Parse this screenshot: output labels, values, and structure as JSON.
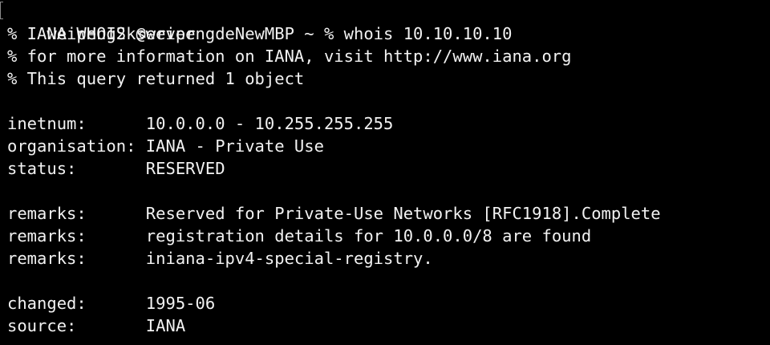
{
  "terminal": {
    "prompt": "weipeng2k@weipengdeNewMBP ~ % ",
    "command": "whois 10.10.10.10",
    "colors": {
      "background": "#000000",
      "text": "#f2f2f2"
    },
    "header_lines": [
      "% IANA WHOIS server",
      "% for more information on IANA, visit http://www.iana.org",
      "% This query returned 1 object"
    ],
    "inetnum": {
      "key": "inetnum:      ",
      "value": "10.0.0.0 - 10.255.255.255"
    },
    "organisation": {
      "key": "organisation: ",
      "value": "IANA - Private Use"
    },
    "status": {
      "key": "status:       ",
      "value": "RESERVED"
    },
    "remarks": [
      {
        "key": "remarks:      ",
        "value": "Reserved for Private-Use Networks [RFC1918].Complete"
      },
      {
        "key": "remarks:      ",
        "value": "registration details for 10.0.0.0/8 are found"
      },
      {
        "key": "remarks:      ",
        "value": "iniana-ipv4-special-registry."
      }
    ],
    "changed": {
      "key": "changed:      ",
      "value": "1995-06"
    },
    "source": {
      "key": "source:       ",
      "value": "IANA"
    }
  }
}
